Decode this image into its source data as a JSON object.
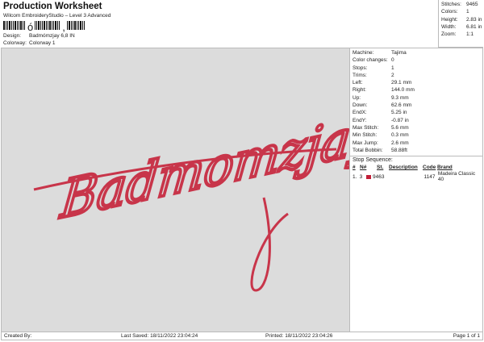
{
  "header": {
    "title": "Production Worksheet",
    "subtitle": "Wilcom EmbroideryStudio – Level 3 Advanced",
    "barcode_text_1": "ó",
    "barcode_text_2": ",",
    "design_label": "Design:",
    "design_value": "Badmómzjay 6,8 IN",
    "colorway_label": "Colorway:",
    "colorway_value": "Colorway 1"
  },
  "summary": [
    {
      "k": "Stitches:",
      "v": "9465"
    },
    {
      "k": "Colors:",
      "v": "1"
    },
    {
      "k": "Height:",
      "v": "2.83 in"
    },
    {
      "k": "Width:",
      "v": "6.81 in"
    },
    {
      "k": "Zoom:",
      "v": "1:1"
    }
  ],
  "details": [
    {
      "k": "Machine:",
      "v": "Tajima"
    },
    {
      "k": "Color changes:",
      "v": "0"
    },
    {
      "k": "Stops:",
      "v": "1"
    },
    {
      "k": "Trims:",
      "v": "2"
    },
    {
      "k": "Left:",
      "v": "29.1 mm"
    },
    {
      "k": "Right:",
      "v": "144.0 mm"
    },
    {
      "k": "Up:",
      "v": "9.3 mm"
    },
    {
      "k": "Down:",
      "v": "62.6 mm"
    },
    {
      "k": "EndX:",
      "v": "5.25 in"
    },
    {
      "k": "EndY:",
      "v": "-0.87 in"
    },
    {
      "k": "Max Stitch:",
      "v": "5.6 mm"
    },
    {
      "k": "Min Stitch:",
      "v": "0.3 mm"
    },
    {
      "k": "Max Jump:",
      "v": "2.6 mm"
    },
    {
      "k": "Total Bobbin:",
      "v": "58.88ft"
    }
  ],
  "stop_sequence": {
    "label": "Stop Sequence:",
    "headers": [
      "#",
      "N#",
      "St.",
      "Description",
      "Code",
      "Brand"
    ],
    "rows": [
      {
        "num": "1.",
        "n": "3",
        "color": "#c21f38",
        "st": "9463",
        "desc": "",
        "code": "1147",
        "brand": "Madeira Classic 40"
      }
    ]
  },
  "design_preview": {
    "text": "Badmomzjay",
    "thread_color": "#c8354a"
  },
  "footer": {
    "created_by": "Created By:",
    "last_saved": "Last Saved: 18/11/2022 23:04:24",
    "printed": "Printed: 18/11/2022 23:04:26",
    "page": "Page 1 of 1"
  }
}
